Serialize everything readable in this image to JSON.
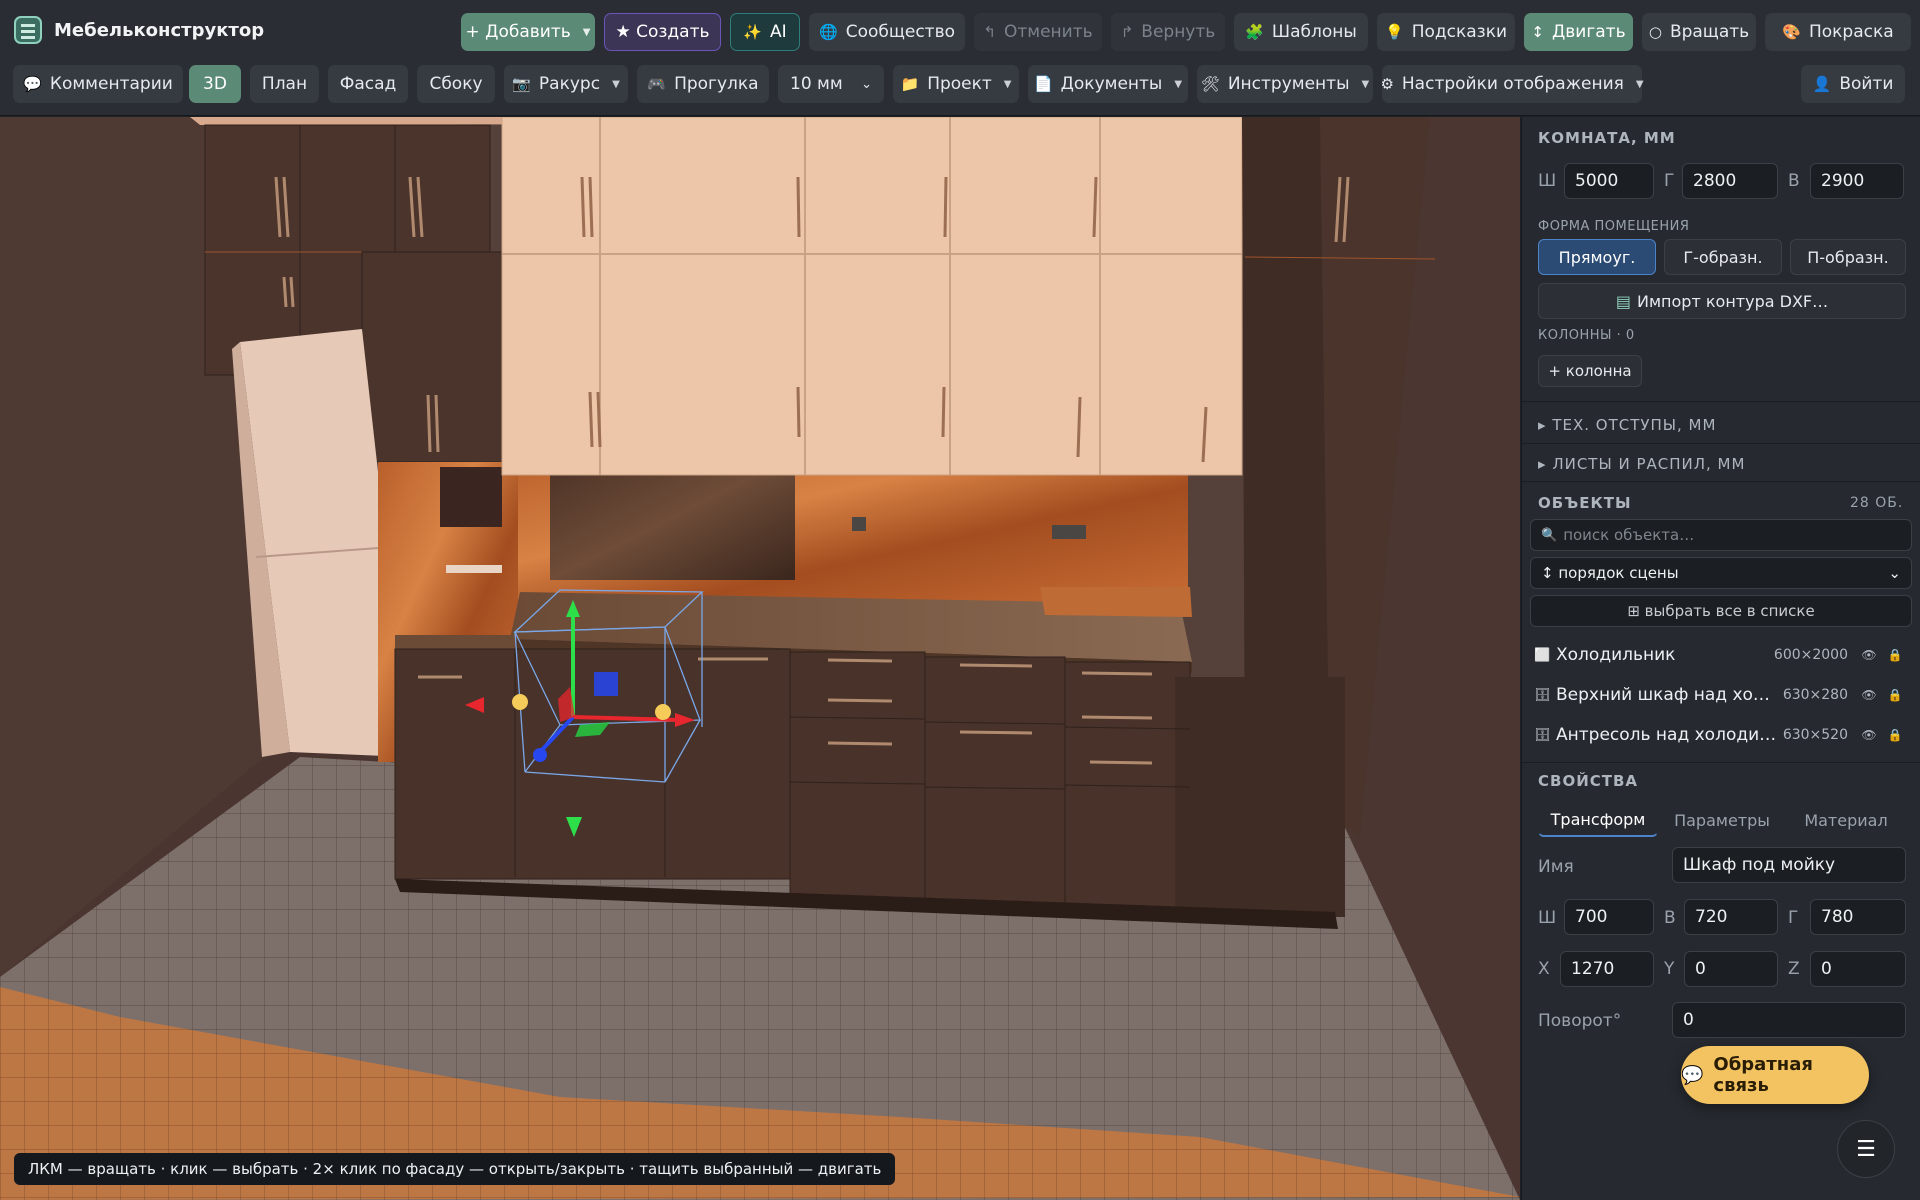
{
  "app": {
    "title": "Мебельконструктор"
  },
  "toolbar1": {
    "add": "+ Добавить",
    "create": "★ Создать",
    "ai": "AI",
    "community": "Сообщество",
    "undo": "Отменить",
    "redo": "Вернуть",
    "templates": "Шаблоны",
    "hints": "Подсказки",
    "move": "Двигать",
    "rotate": "Вращать",
    "paint": "Покраска"
  },
  "toolbar2": {
    "comments": "Комментарии",
    "view3d": "3D",
    "plan": "План",
    "facade": "Фасад",
    "side": "Сбоку",
    "angle": "Ракурс",
    "walk": "Прогулка",
    "step": "10 мм",
    "project": "Проект",
    "documents": "Документы",
    "tools": "Инструменты",
    "display": "Настройки отображения",
    "login": "Войти"
  },
  "room": {
    "title": "КОМНАТА, ММ",
    "w_label": "Ш",
    "w": "5000",
    "d_label": "Г",
    "d": "2800",
    "h_label": "В",
    "h": "2900",
    "shape_title": "ФОРМА ПОМЕЩЕНИЯ",
    "shapes": [
      "Прямоуг.",
      "Г-образн.",
      "П-образн."
    ],
    "import_dxf": "Импорт контура DXF…",
    "columns_label": "КОЛОННЫ · 0",
    "add_column": "+ колонна",
    "tech_offsets": "ТЕХ. ОТСТУПЫ, ММ",
    "sheets": "ЛИСТЫ И РАСПИЛ, ММ"
  },
  "objects": {
    "title": "ОБЪЕКТЫ",
    "count": "28 ОБ.",
    "search_placeholder": "поиск объекта…",
    "order": "↕ порядок сцены",
    "select_all": "⊞ выбрать все в списке",
    "items": [
      {
        "name": "Холодильник",
        "dims": "600×2000"
      },
      {
        "name": "Верхний шкаф над холодильником",
        "dims": "630×280"
      },
      {
        "name": "Антресоль над холодильником",
        "dims": "630×520"
      }
    ]
  },
  "props": {
    "title": "СВОЙСТВА",
    "tabs": [
      "Трансформ",
      "Параметры",
      "Материал"
    ],
    "name_label": "Имя",
    "name": "Шкаф под мойку",
    "w_label": "Ш",
    "w": "700",
    "h_label": "В",
    "h": "720",
    "d_label": "Г",
    "d": "780",
    "x_label": "X",
    "x": "1270",
    "y_label": "Y",
    "y": "0",
    "z_label": "Z",
    "z": "0",
    "rot_label": "Поворот°",
    "rot": "0"
  },
  "feedback": "Обратная связь",
  "status_hint": "ЛКМ — вращать · клик — выбрать · 2× клик по фасаду — открыть/закрыть · тащить выбранный — двигать",
  "colors": {
    "accent_green": "#5b8a76",
    "accent_blue": "#4d84c9",
    "feedback": "#f3c362"
  }
}
